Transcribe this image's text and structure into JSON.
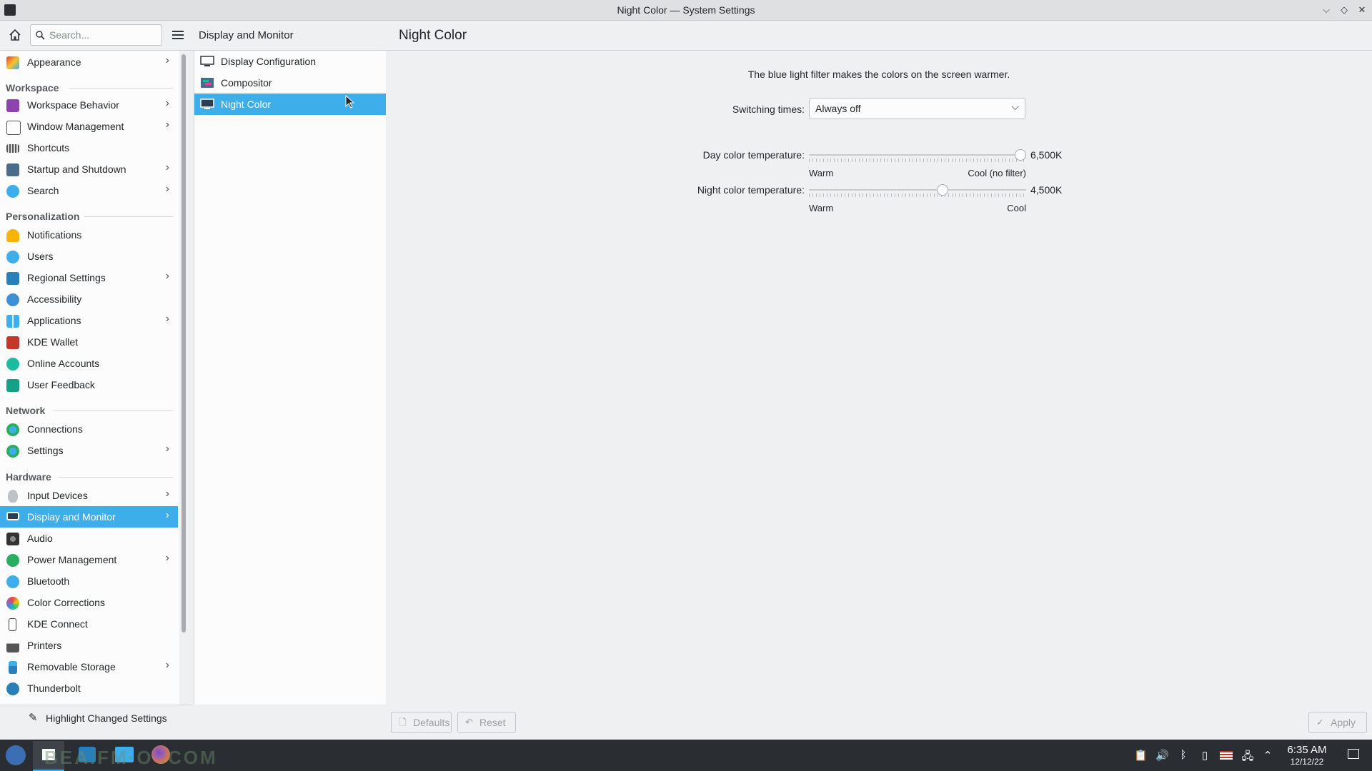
{
  "window": {
    "title": "Night Color — System Settings"
  },
  "header": {
    "search_placeholder": "Search...",
    "section_title": "Display and Monitor",
    "page_title": "Night Color"
  },
  "sidebar": {
    "appearance": "Appearance",
    "workspace_header": "Workspace",
    "workspace": [
      "Workspace Behavior",
      "Window Management",
      "Shortcuts",
      "Startup and Shutdown",
      "Search"
    ],
    "personalization_header": "Personalization",
    "personalization": [
      "Notifications",
      "Users",
      "Regional Settings",
      "Accessibility",
      "Applications",
      "KDE Wallet",
      "Online Accounts",
      "User Feedback"
    ],
    "network_header": "Network",
    "network": [
      "Connections",
      "Settings"
    ],
    "hardware_header": "Hardware",
    "hardware": [
      "Input Devices",
      "Display and Monitor",
      "Audio",
      "Power Management",
      "Bluetooth",
      "Color Corrections",
      "KDE Connect",
      "Printers",
      "Removable Storage",
      "Thunderbolt"
    ],
    "highlight_button": "Highlight Changed Settings"
  },
  "subpages": [
    "Display Configuration",
    "Compositor",
    "Night Color"
  ],
  "content": {
    "description": "The blue light filter makes the colors on the screen warmer.",
    "switching_label": "Switching times:",
    "switching_value": "Always off",
    "day_label": "Day color temperature:",
    "day_value": "6,500K",
    "day_min_label": "Warm",
    "day_max_label": "Cool (no filter)",
    "day_level": 1.0,
    "night_label": "Night color temperature:",
    "night_value": "4,500K",
    "night_min_label": "Warm",
    "night_max_label": "Cool",
    "night_level": 0.62
  },
  "footer": {
    "defaults": "Defaults",
    "reset": "Reset",
    "apply": "Apply"
  },
  "taskbar": {
    "time": "6:35 AM",
    "date": "12/12/22",
    "watermark": "BEA.FM·O .COM"
  },
  "colors": {
    "selection": "#3daee9",
    "taskbar": "#2a2e32"
  }
}
